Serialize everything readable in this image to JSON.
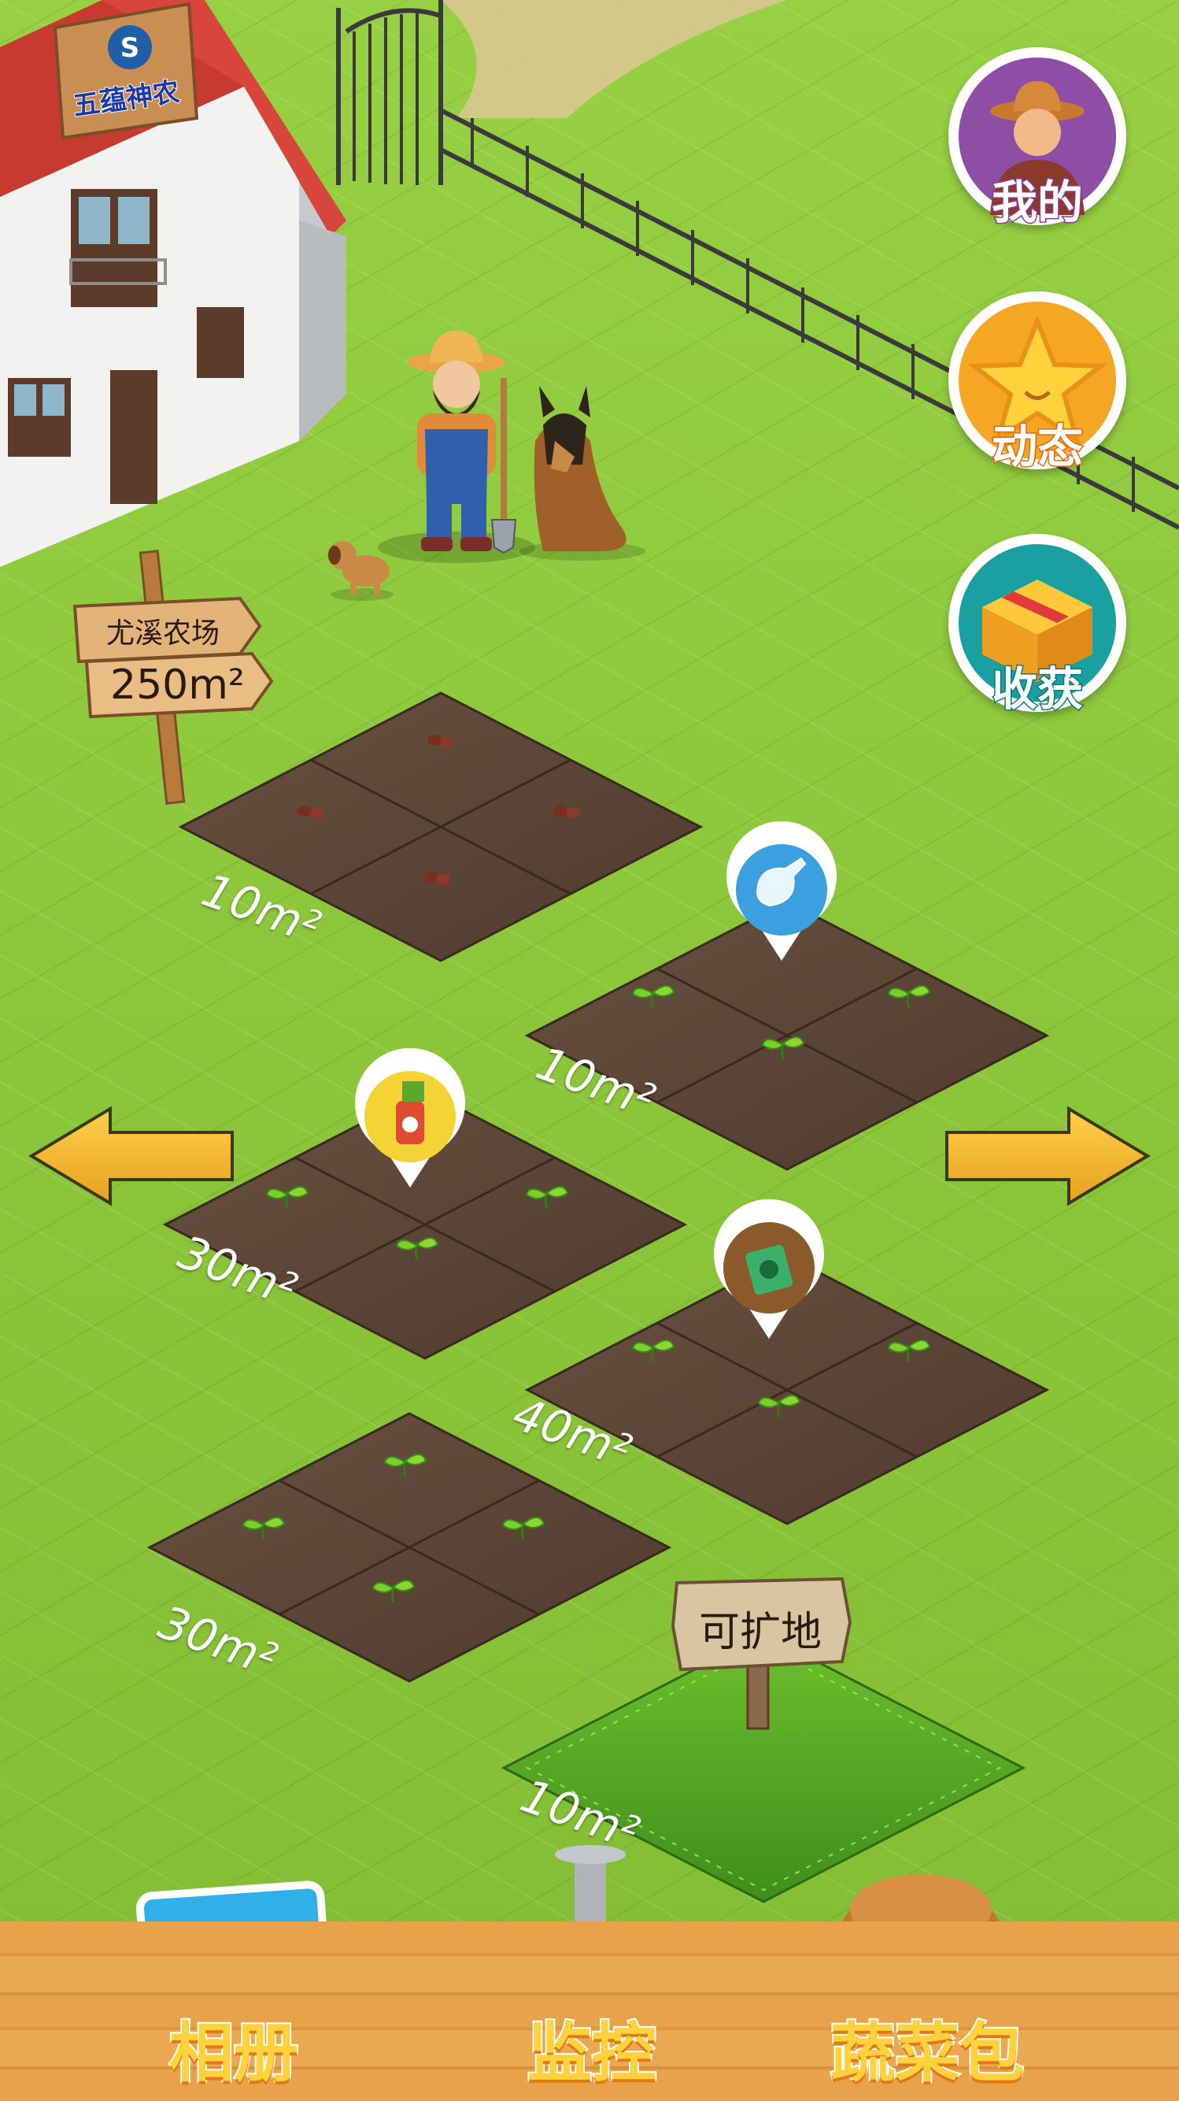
{
  "logo": {
    "text": "五蕴神农"
  },
  "farm_sign": {
    "name": "尤溪农场",
    "area": "250m²"
  },
  "side_menu": [
    {
      "label": "我的",
      "icon": "farmer-avatar-icon",
      "color": "#8e4ea6"
    },
    {
      "label": "动态",
      "icon": "star-icon",
      "color": "#f5a623"
    },
    {
      "label": "收获",
      "icon": "box-icon",
      "color": "#1aa0a0"
    }
  ],
  "plots": [
    {
      "area": "10m²",
      "crop": "seeds"
    },
    {
      "area": "10m²",
      "crop": "sprouts",
      "action": "water-icon"
    },
    {
      "area": "30m²",
      "crop": "sprouts",
      "action": "spray-icon"
    },
    {
      "area": "40m²",
      "crop": "sprouts",
      "action": "fertilizer-icon"
    },
    {
      "area": "30m²",
      "crop": "sprouts"
    },
    {
      "area": "10m²",
      "crop": "grass",
      "sign": "可扩地"
    }
  ],
  "nav_arrows": {
    "left": "left-arrow-icon",
    "right": "right-arrow-icon"
  },
  "bottom_bar": [
    {
      "label": "相册",
      "icon": "photo-album-icon"
    },
    {
      "label": "监控",
      "icon": "camera-icon"
    },
    {
      "label": "蔬菜包",
      "icon": "backpack-icon"
    }
  ],
  "colors": {
    "grass": "#8cc83a",
    "soil": "#5a4434",
    "wood": "#e8a24a",
    "accent": "#ffd23c"
  }
}
